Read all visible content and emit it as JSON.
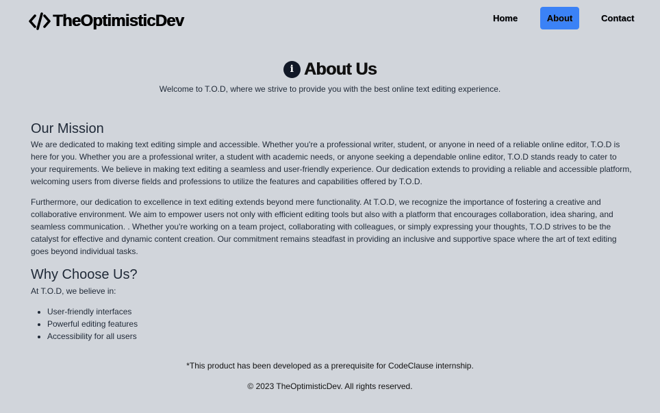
{
  "navbar": {
    "brand": "TheOptimisticDev",
    "brand_icon": "code-icon",
    "links": [
      {
        "label": "Home",
        "active": false
      },
      {
        "label": "About",
        "active": true
      },
      {
        "label": "Contact",
        "active": false
      }
    ],
    "active_color": "#3b82f6"
  },
  "hero": {
    "icon": "info-icon",
    "title": "About Us",
    "subtitle": "Welcome to T.O.D, where we strive to provide you with the best online text editing experience."
  },
  "mission": {
    "heading": "Our Mission",
    "paragraphs": [
      "We are dedicated to making text editing simple and accessible. Whether you're a professional writer, student, or anyone in need of a reliable online editor, T.O.D is here for you. Whether you are a professional writer, a student with academic needs, or anyone seeking a dependable online editor, T.O.D stands ready to cater to your requirements. We believe in making text editing a seamless and user-friendly experience. Our dedication extends to providing a reliable and accessible platform, welcoming users from diverse fields and professions to utilize the features and capabilities offered by T.O.D.",
      "Furthermore, our dedication to excellence in text editing extends beyond mere functionality. At T.O.D, we recognize the importance of fostering a creative and collaborative environment. We aim to empower users not only with efficient editing tools but also with a platform that encourages collaboration, idea sharing, and seamless communication. . Whether you're working on a team project, collaborating with colleagues, or simply expressing your thoughts, T.O.D strives to be the catalyst for effective and dynamic content creation. Our commitment remains steadfast in providing an inclusive and supportive space where the art of text editing goes beyond individual tasks."
    ]
  },
  "why": {
    "heading": "Why Choose Us?",
    "intro": "At T.O.D, we believe in:",
    "items": [
      "User-friendly interfaces",
      "Powerful editing features",
      "Accessibility for all users"
    ]
  },
  "footer": {
    "note": "*This product has been developed as a prerequisite for CodeClause internship.",
    "copyright": "© 2023 TheOptimisticDev. All rights reserved."
  }
}
